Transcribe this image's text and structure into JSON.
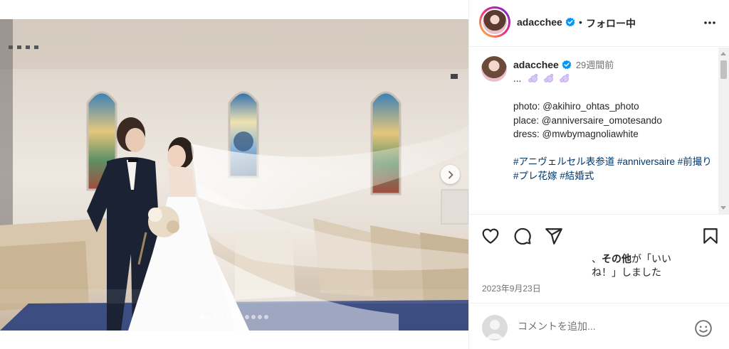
{
  "post": {
    "image_description_alt": "",
    "carousel": {
      "count": 11,
      "active_index": 0
    },
    "next_icon": "chevron-right-icon"
  },
  "header": {
    "username": "adacchee",
    "separator": "•",
    "follow_status": "フォロー中",
    "more_icon": "more-horizontal-icon"
  },
  "caption": {
    "username": "adacchee",
    "time_ago": "29週間前",
    "first_line": "...",
    "lines": [
      "photo: @akihiro_ohtas_photo",
      "place: @anniversaire_omotesando",
      "dress: @mwbymagnoliawhite"
    ],
    "hashtags": "#アニヴェルセル表参道 #anniversaire #前撮り #プレ花嫁 #結婚式"
  },
  "actions": {
    "like_icon": "heart-icon",
    "comment_icon": "comment-icon",
    "share_icon": "share-icon",
    "save_icon": "bookmark-icon"
  },
  "likes": {
    "prefix": "、",
    "bold": "その他",
    "suffix": "が「いいね！」しました"
  },
  "date": "2023年9月23日",
  "add_comment": {
    "placeholder": "コメントを追加...",
    "emoji_icon": "emoji-icon"
  },
  "colors": {
    "accent_link": "#00376b",
    "verified": "#0095f6",
    "muted": "#737373",
    "border": "#efefef"
  }
}
